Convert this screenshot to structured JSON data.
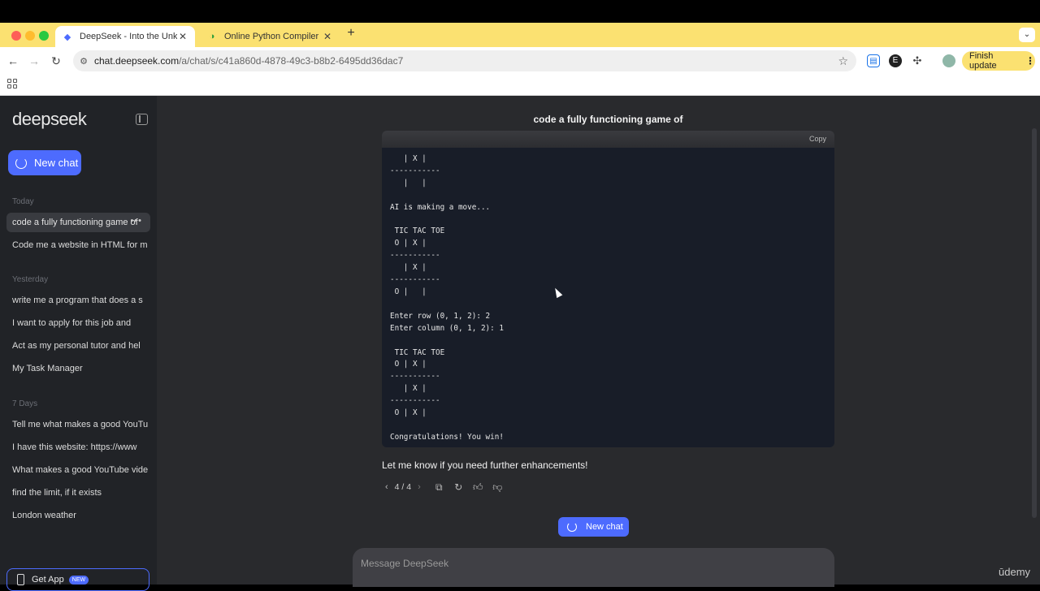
{
  "colors": {
    "tabbar": "#fbe171",
    "accent": "#4d6bfe",
    "sidebar": "#212327",
    "main": "#292a2d",
    "code_bg": "#181d28"
  },
  "browser": {
    "tabs": [
      {
        "title": "DeepSeek - Into the Unknown",
        "favicon": "whale-icon",
        "active": true
      },
      {
        "title": "Online Python Compiler",
        "favicon": "compiler-icon",
        "active": false
      }
    ],
    "url_host": "chat.deepseek.com",
    "url_path": "/a/chat/s/c41a860d-4878-49c3-b8b2-6495dd36dac7",
    "profile_initial": "E",
    "finish_update": "Finish update"
  },
  "sidebar": {
    "logo": "deepseek",
    "new_chat": "New chat",
    "sections": [
      {
        "label": "Today",
        "items": [
          "code a fully functioning game of",
          "Code me a website in HTML for m"
        ]
      },
      {
        "label": "Yesterday",
        "items": [
          "write me a program that does a s",
          "I want to apply for this job and",
          "Act as my personal tutor and hel",
          "My Task Manager"
        ]
      },
      {
        "label": "7 Days",
        "items": [
          "Tell me what makes a good YouTu",
          "I have this website: https://www",
          "What makes a good YouTube vide",
          "find the limit, if it exists",
          "London weather"
        ]
      }
    ],
    "get_app": "Get App",
    "get_app_badge": "NEW"
  },
  "chat": {
    "title": "code a fully functioning game of",
    "copy_label": "Copy",
    "code_lines": [
      "   | X |",
      "-----------",
      "   |   |",
      "",
      "AI is making a move...",
      "",
      " TIC TAC TOE",
      " O | X |",
      "-----------",
      "   | X |",
      "-----------",
      " O |   |",
      "",
      "Enter row (0, 1, 2): 2",
      "Enter column (0, 1, 2): 1",
      "",
      " TIC TAC TOE",
      " O | X |",
      "-----------",
      "   | X |",
      "-----------",
      " O | X |",
      "",
      "Congratulations! You win!"
    ],
    "after_text": "Let me know if you need further enhancements!",
    "pagination": "4 / 4",
    "new_chat": "New chat",
    "composer_placeholder": "Message DeepSeek"
  },
  "watermark": "ūdemy"
}
